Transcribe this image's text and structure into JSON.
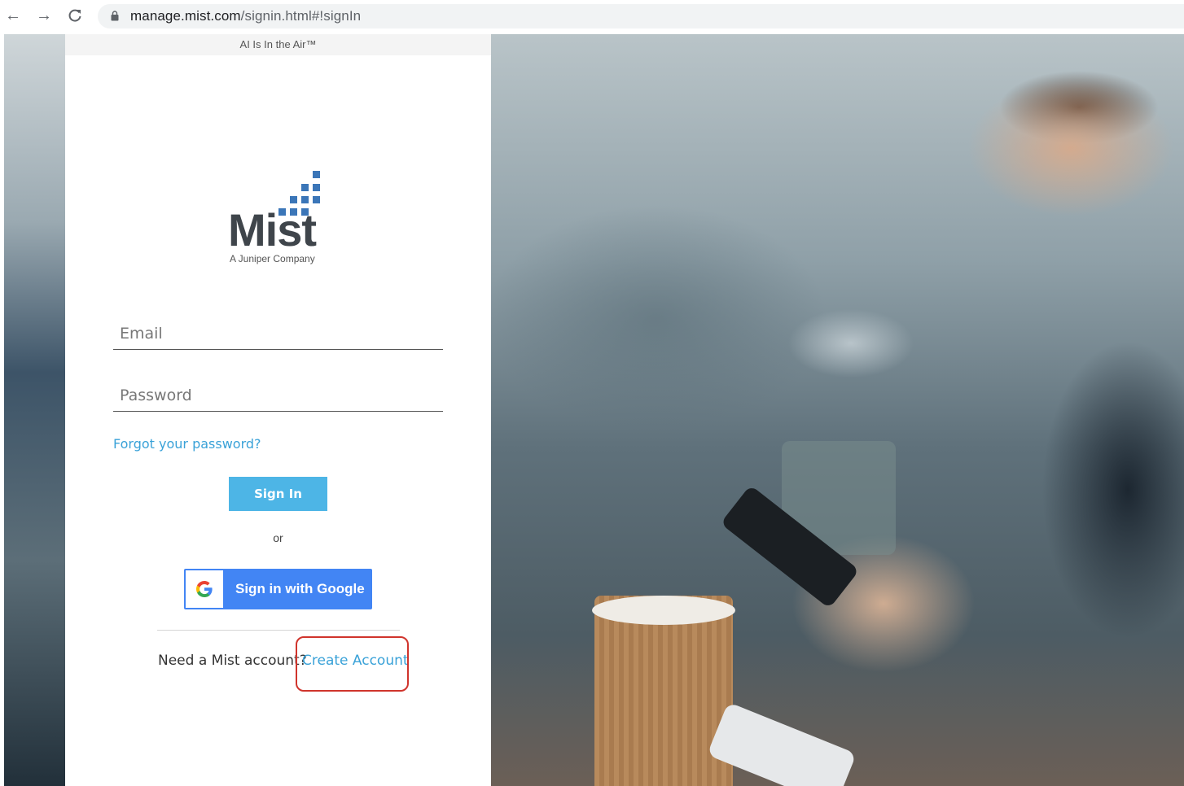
{
  "browser": {
    "back_icon": "arrow-left-icon",
    "forward_icon": "arrow-right-icon",
    "reload_icon": "reload-icon",
    "lock_icon": "lock-icon",
    "url_host": "manage.mist.com",
    "url_path": "/signin.html#!signIn"
  },
  "page": {
    "tagline": "AI Is In the Air™",
    "logo": {
      "wordmark": "Mist",
      "subtitle": "A Juniper Company",
      "brand_color": "#3b76b8"
    },
    "form": {
      "email_placeholder": "Email",
      "password_placeholder": "Password",
      "forgot_link": "Forgot your password?",
      "signin_button": "Sign In",
      "or_text": "or",
      "google_button": "Sign in with Google",
      "need_account_text": "Need a Mist account?",
      "create_account_link": "Create Account",
      "link_color": "#3aa2d8",
      "button_color": "#4db5e6",
      "google_color": "#4285f4",
      "highlight_color": "#d0342c"
    }
  }
}
